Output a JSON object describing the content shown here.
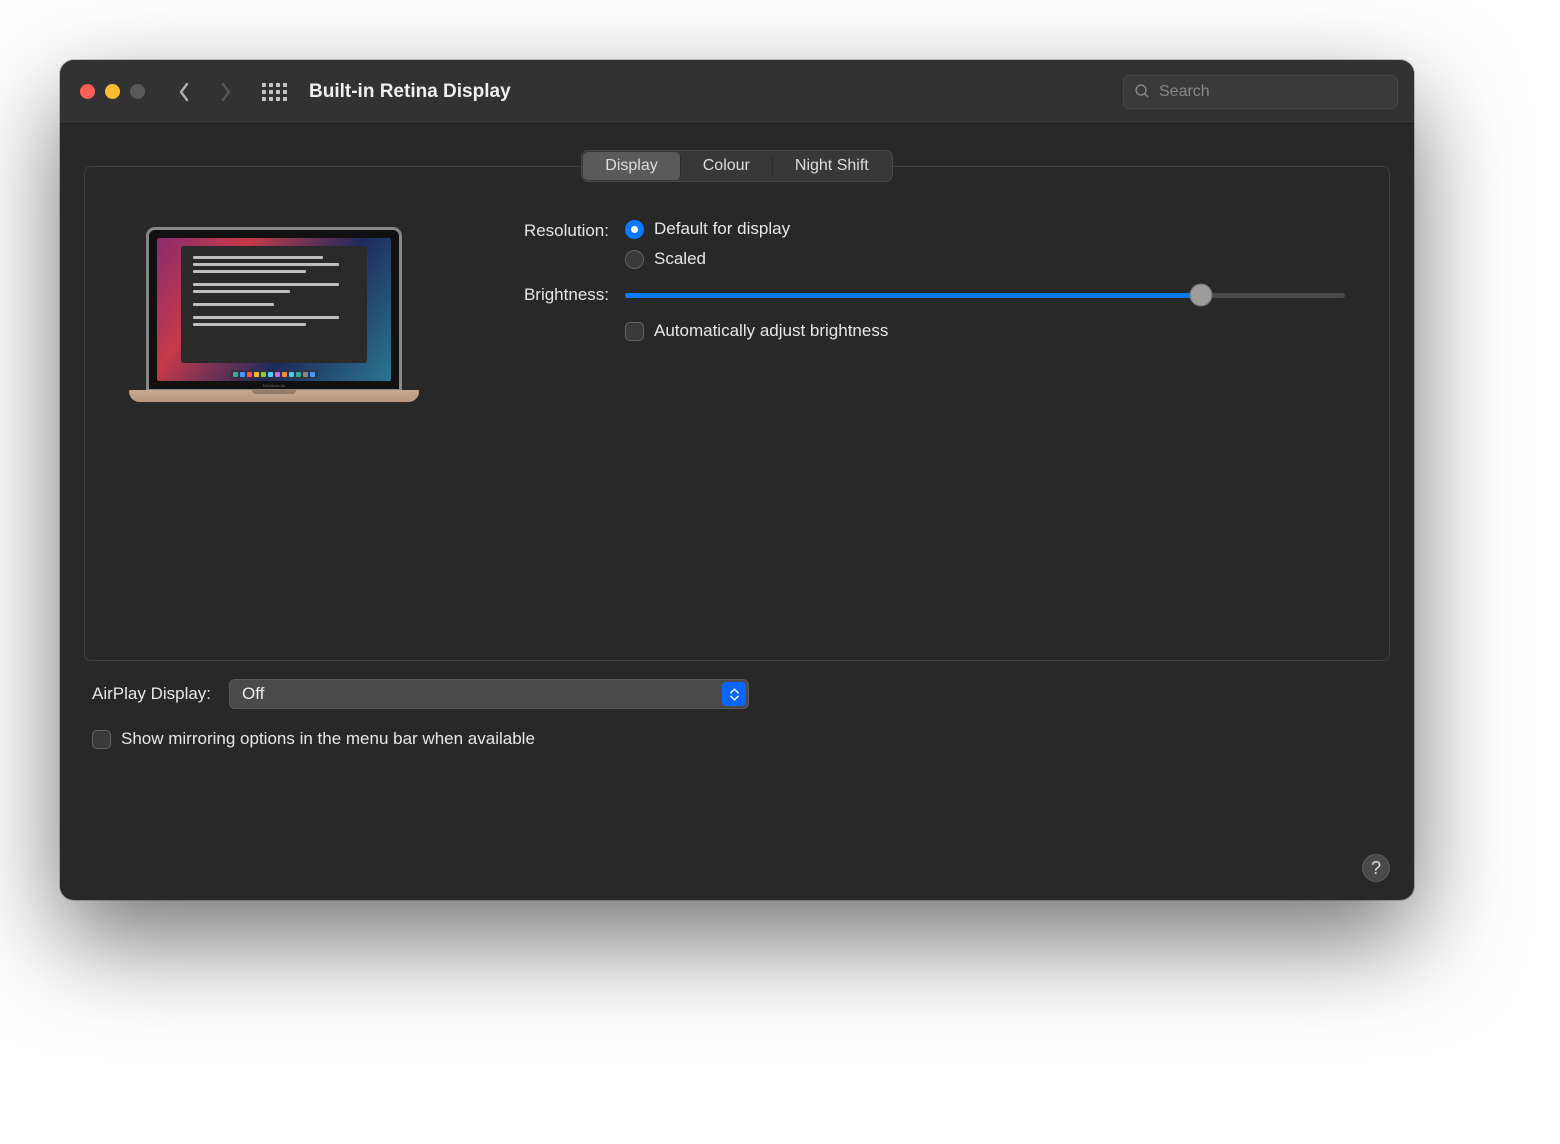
{
  "window": {
    "title": "Built-in Retina Display"
  },
  "search": {
    "placeholder": "Search"
  },
  "tabs": [
    {
      "label": "Display",
      "active": true
    },
    {
      "label": "Colour",
      "active": false
    },
    {
      "label": "Night Shift",
      "active": false
    }
  ],
  "resolution": {
    "label": "Resolution:",
    "options": [
      {
        "label": "Default for display",
        "selected": true
      },
      {
        "label": "Scaled",
        "selected": false
      }
    ]
  },
  "brightness": {
    "label": "Brightness:",
    "value_percent": 80,
    "auto_checkbox_label": "Automatically adjust brightness",
    "auto_checked": false
  },
  "preview": {
    "device_label": "MacBook Air"
  },
  "airplay": {
    "label": "AirPlay Display:",
    "selected": "Off"
  },
  "mirroring": {
    "label": "Show mirroring options in the menu bar when available",
    "checked": false
  },
  "help_symbol": "?"
}
